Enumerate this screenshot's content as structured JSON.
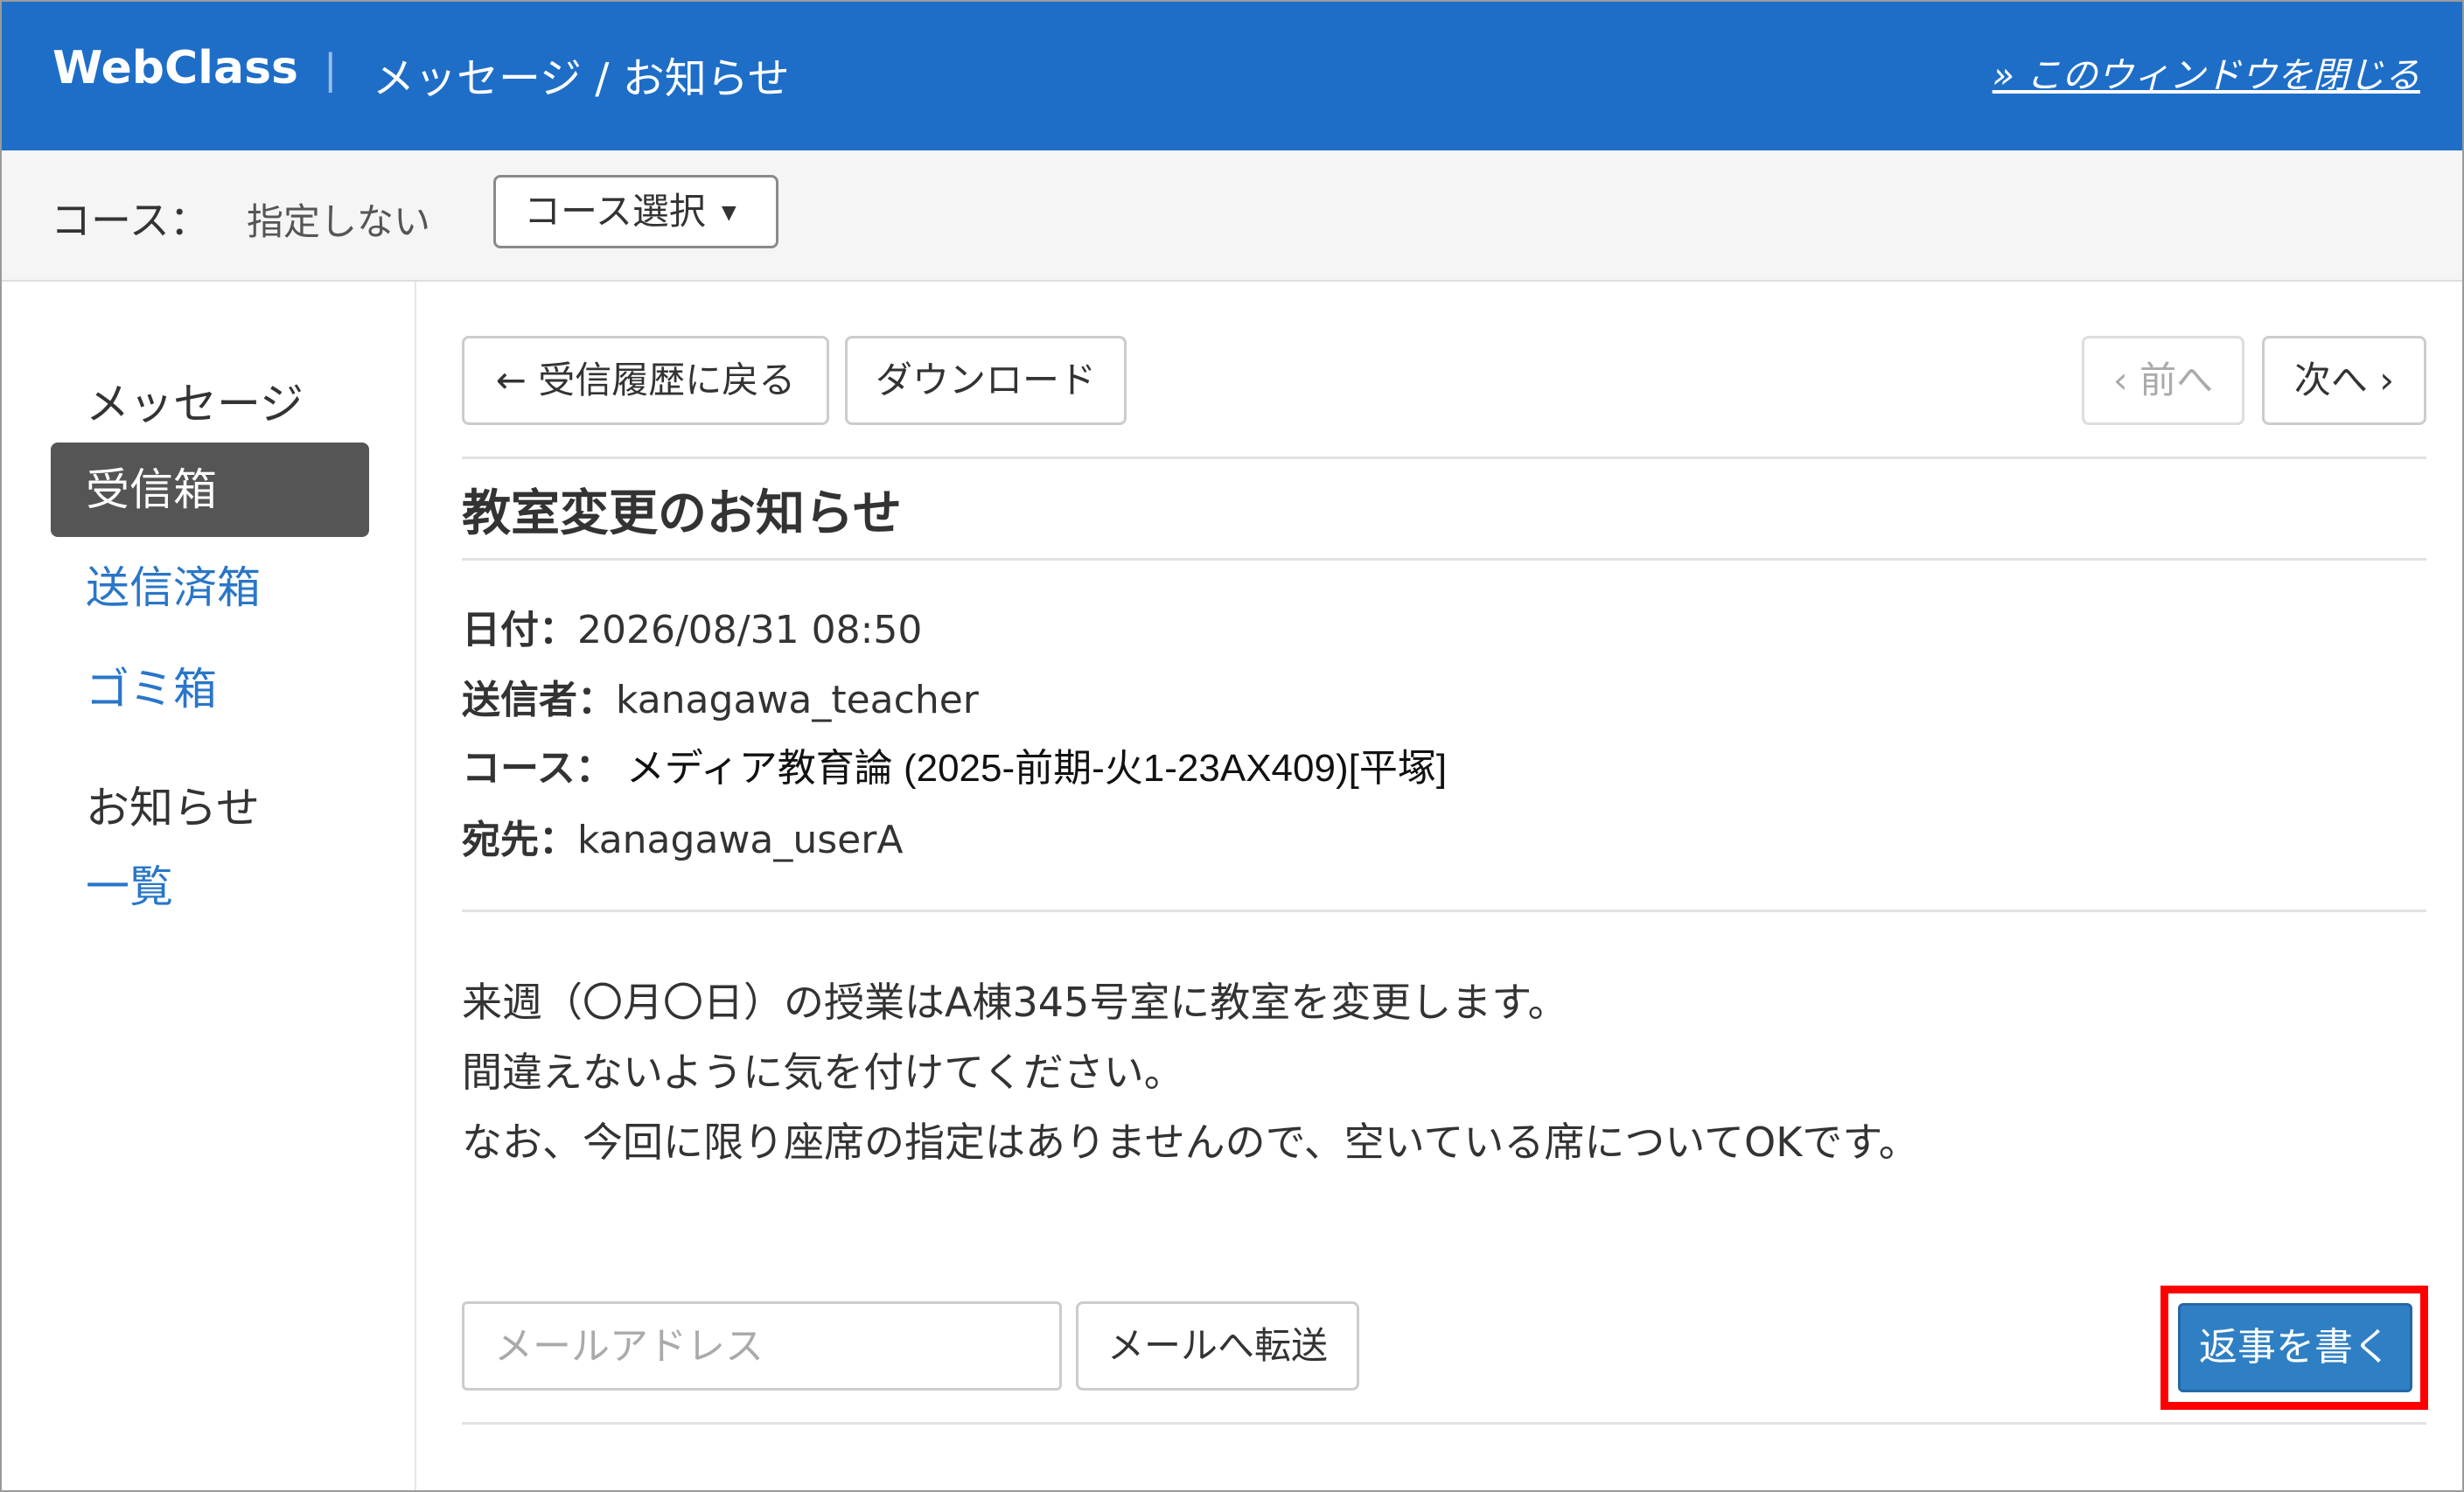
{
  "header": {
    "brand": "WebClass",
    "separator": "|",
    "title": "メッセージ / お知らせ",
    "close_link": "» このウィンドウを閉じる"
  },
  "course_bar": {
    "label": "コース：",
    "value": "指定しない",
    "select_label": "コース選択",
    "select_caret": "▼"
  },
  "sidebar": {
    "messages_heading": "メッセージ",
    "inbox": "受信箱",
    "sent": "送信済箱",
    "trash": "ゴミ箱",
    "notices_heading": "お知らせ",
    "list": "一覧"
  },
  "toolbar": {
    "back_button": "← 受信履歴に戻る",
    "download_button": "ダウンロード",
    "prev_button": "‹ 前へ",
    "next_button": "次へ ›"
  },
  "message": {
    "subject": "教室変更のお知らせ",
    "date_label": "日付：",
    "date_value": "2026/08/31 08:50",
    "sender_label": "送信者：",
    "sender_value": "kanagawa_teacher",
    "course_label": "コース：",
    "course_value": "メディア教育論 (2025-前期-火1-23AX409)[平塚]",
    "recipient_label": "宛先：",
    "recipient_value": "kanagawa_userA",
    "body": [
      "来週（〇月〇日）の授業はA棟345号室に教室を変更します。",
      "間違えないように気を付けてください。",
      "なお、今回に限り座席の指定はありませんので、空いている席についてOKです。"
    ]
  },
  "footer": {
    "email_placeholder": "メールアドレス",
    "forward_button": "メールへ転送",
    "reply_button": "返事を書く"
  },
  "colors": {
    "header_bg": "#1e6ec8",
    "active_item_bg": "#555555",
    "link": "#2a76c8",
    "reply_button_bg": "#2f7fc4",
    "highlight": "#ff0000"
  }
}
